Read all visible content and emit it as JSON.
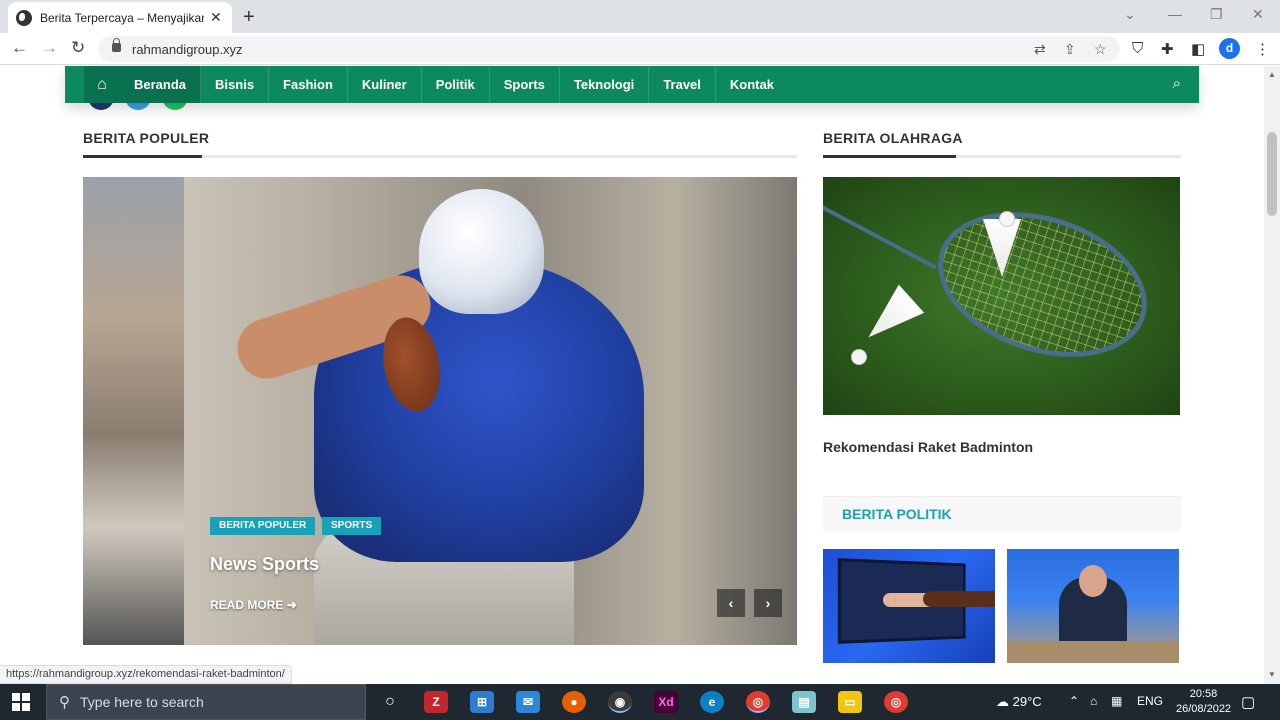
{
  "browser": {
    "tab_title": "Berita Terpercaya – Menyajikan b",
    "new_tab": "+",
    "close": "✕",
    "url": "rahmandigroup.xyz",
    "avatar_letter": "d",
    "status_url": "https://rahmandigroup.xyz/rekomendasi-raket-badminton/"
  },
  "nav": {
    "items": [
      {
        "label": "Beranda"
      },
      {
        "label": "Bisnis"
      },
      {
        "label": "Fashion"
      },
      {
        "label": "Kuliner"
      },
      {
        "label": "Politik"
      },
      {
        "label": "Sports"
      },
      {
        "label": "Teknologi"
      },
      {
        "label": "Travel"
      },
      {
        "label": "Kontak"
      }
    ],
    "active": "Beranda",
    "colors": {
      "bar": "#0c8a5e",
      "active": "#097050"
    }
  },
  "popular": {
    "title": "BERITA POPULER",
    "slide": {
      "tags": [
        "BERITA POPULER",
        "SPORTS"
      ],
      "title": "News Sports",
      "read_more": "READ MORE",
      "prev_arrow": "‹",
      "next_arrow": "›"
    }
  },
  "sports": {
    "title": "BERITA OLAHRAGA",
    "caption": "Rekomendasi Raket Badminton"
  },
  "politik": {
    "title": "BERITA POLITIK"
  },
  "taskbar": {
    "search_placeholder": "Type here to search",
    "temperature": "29°C",
    "language": "ENG",
    "time": "20:58",
    "date": "26/08/2022"
  },
  "icons": {
    "home": "⌂",
    "search": "⚲",
    "arrow_right": "➜"
  },
  "accent_colors": {
    "tag": "#17a2b8",
    "politik_title": "#1aa3b6"
  }
}
